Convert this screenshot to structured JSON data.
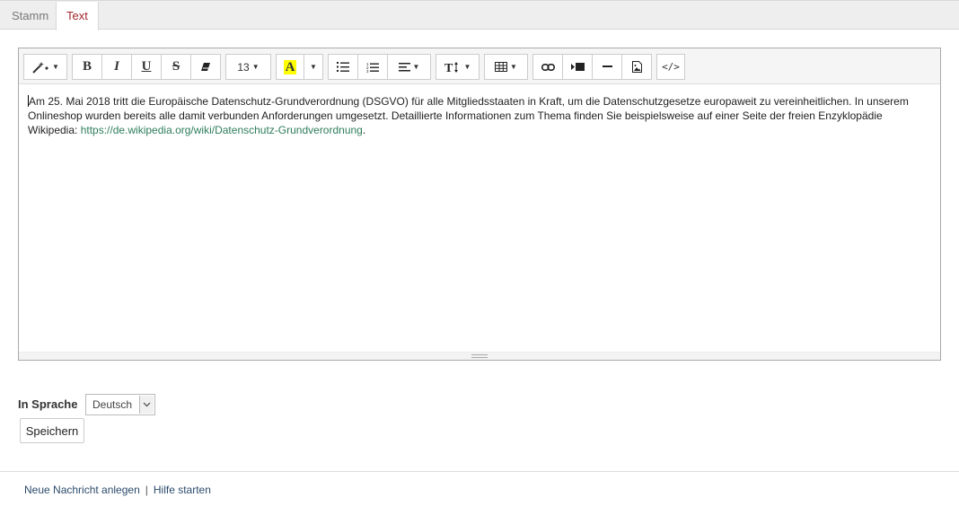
{
  "tabs": [
    {
      "label": "Stamm"
    },
    {
      "label": "Text"
    }
  ],
  "toolbar": {
    "font_size": "13",
    "icons": [
      "magic-icon",
      "bold-icon",
      "italic-icon",
      "underline-icon",
      "strikethrough-icon",
      "eraser-icon",
      "font-size-dropdown",
      "highlight-color-icon",
      "unordered-list-icon",
      "ordered-list-icon",
      "align-icon",
      "line-height-icon",
      "table-icon",
      "link-icon",
      "video-icon",
      "horizontal-rule-icon",
      "picture-icon",
      "code-view-icon"
    ],
    "highlight_color": "#ffff00",
    "bold_glyph": "B",
    "italic_glyph": "I",
    "underline_glyph": "U",
    "strike_glyph": "S",
    "highlight_glyph": "A",
    "code_glyph": "</>"
  },
  "editor": {
    "text_before": "Am 25. Mai 2018 tritt die Europäische Datenschutz-Grundverordnung (DSGVO) für alle Mitgliedsstaaten in Kraft, um die Datenschutzgesetze europaweit zu vereinheitlichen. In unserem Onlineshop wurden bereits alle damit verbunden Anforderungen umgesetzt. Detaillierte Informationen zum Thema finden Sie beispielsweise auf einer Seite der freien Enzyklopädie Wikipedia: ",
    "link_text": "https://de.wikipedia.org/wiki/Datenschutz-Grundverordnung",
    "text_after": "."
  },
  "language": {
    "label": "In Sprache",
    "selected": "Deutsch"
  },
  "save_label": "Speichern",
  "footer": {
    "link_new": "Neue Nachricht anlegen",
    "separator": "|",
    "link_help": "Hilfe starten"
  },
  "colors": {
    "active_tab_text": "#a0282d",
    "link": "#2e7d5b",
    "footer_link": "#2a4a6b"
  }
}
